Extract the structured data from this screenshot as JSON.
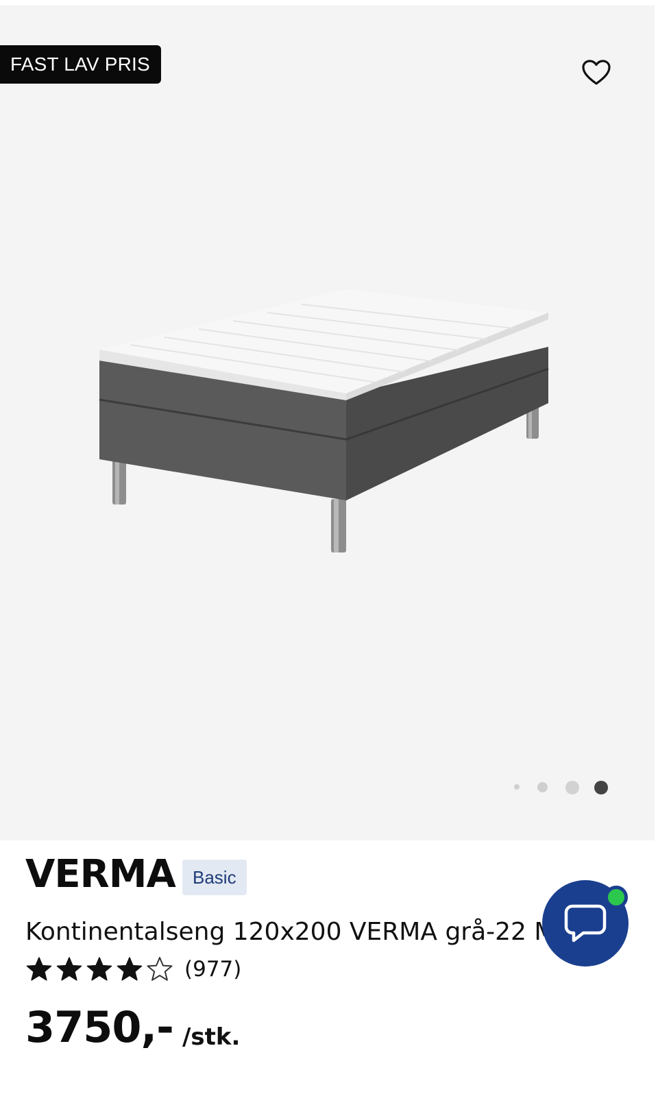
{
  "gallery": {
    "badge": "FAST LAV PRIS",
    "favorite_icon": "heart-outline-icon",
    "slide_count": 4,
    "active_slide": 4
  },
  "product": {
    "brand": "VERMA",
    "tag": "Basic",
    "title": "Kontinentalseng 120x200 VERMA grå-22 M",
    "rating": 4,
    "rating_max": 5,
    "reviews": "(977)",
    "price": "3750,-",
    "unit": "/stk."
  },
  "chat": {
    "icon": "chat-bubble-icon",
    "status_color": "#2cc84d"
  },
  "colors": {
    "accent": "#1b3f8f",
    "badge_bg": "#0a0a0a",
    "tag_bg": "#e3e9f3",
    "tag_text": "#1d3c78"
  }
}
